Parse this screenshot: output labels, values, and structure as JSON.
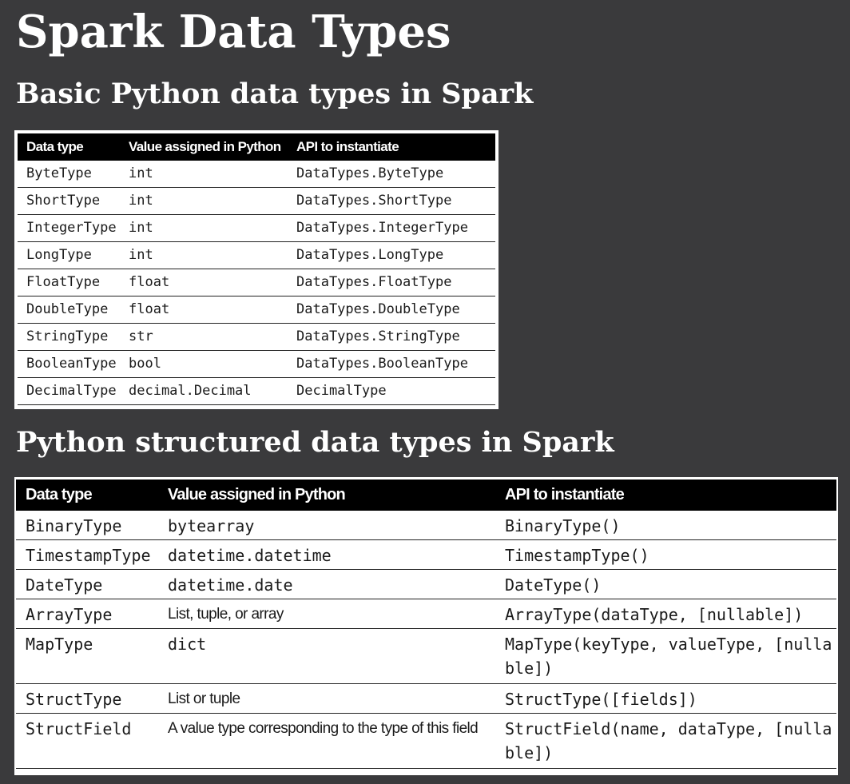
{
  "page": {
    "title": "Spark Data Types",
    "subtitle_basic": "Basic Python data types in Spark",
    "subtitle_structured": "Python structured data types in Spark"
  },
  "basic_table": {
    "headers": [
      "Data type",
      "Value assigned in Python",
      "API to instantiate"
    ],
    "rows": [
      [
        "ByteType",
        "int",
        "DataTypes.ByteType"
      ],
      [
        "ShortType",
        "int",
        "DataTypes.ShortType"
      ],
      [
        "IntegerType",
        "int",
        "DataTypes.IntegerType"
      ],
      [
        "LongType",
        "int",
        "DataTypes.LongType"
      ],
      [
        "FloatType",
        "float",
        "DataTypes.FloatType"
      ],
      [
        "DoubleType",
        "float",
        "DataTypes.DoubleType"
      ],
      [
        "StringType",
        "str",
        "DataTypes.StringType"
      ],
      [
        "BooleanType",
        "bool",
        "DataTypes.BooleanType"
      ],
      [
        "DecimalType",
        "decimal.Decimal",
        "DecimalType"
      ]
    ]
  },
  "structured_table": {
    "headers": [
      "Data type",
      "Value assigned in Python",
      "API to instantiate"
    ],
    "rows": [
      [
        "BinaryType",
        "bytearray",
        "BinaryType()"
      ],
      [
        "TimestampType",
        "datetime.datetime",
        "TimestampType()"
      ],
      [
        "DateType",
        "datetime.date",
        "DateType()"
      ],
      [
        "ArrayType",
        "List, tuple, or array",
        "ArrayType(dataType, [nullable])"
      ],
      [
        "MapType",
        "dict",
        "MapType(keyType, valueType, [nullable])"
      ],
      [
        "StructType",
        "List or tuple",
        "StructType([fields])"
      ],
      [
        "StructField",
        "A value type corresponding to the type of this field",
        "StructField(name, dataType, [nullable])"
      ]
    ]
  },
  "colors": {
    "background": "#3a3a3c",
    "table_header": "#000000",
    "table_body": "#ffffff"
  }
}
